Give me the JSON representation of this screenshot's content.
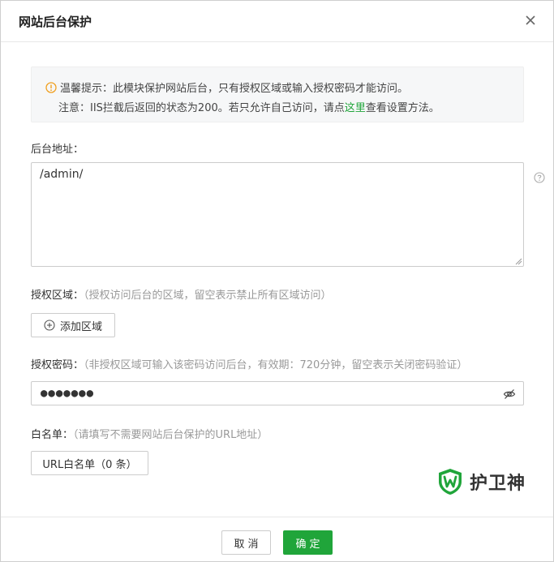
{
  "dialog": {
    "title": "网站后台保护",
    "close_icon": "close-icon"
  },
  "notice": {
    "icon": "warning-circle-icon",
    "line1": "温馨提示：此模块保护网站后台，只有授权区域或输入授权密码才能访问。",
    "line2_before": "注意：IIS拦截后返回的状态为200。若只允许自己访问，请点",
    "line2_link": "这里",
    "line2_after": "查看设置方法。"
  },
  "backend_path": {
    "label": "后台地址：",
    "value": "/admin/",
    "help_icon": "question-circle-icon"
  },
  "auth_region": {
    "label": "授权区域：",
    "hint": "（授权访问后台的区域，留空表示禁止所有区域访问）",
    "add_button_label": "添加区域",
    "add_icon": "plus-circle-icon"
  },
  "auth_password": {
    "label": "授权密码：",
    "hint": "（非授权区域可输入该密码访问后台，有效期：720分钟，留空表示关闭密码验证）",
    "value": "●●●●●●●",
    "eye_icon": "eye-off-icon"
  },
  "whitelist": {
    "label": "白名单：",
    "hint": "（请填写不需要网站后台保护的URL地址）",
    "button_label": "URL白名单（0 条）"
  },
  "brand": {
    "name": "护卫神",
    "icon": "shield-w-logo"
  },
  "footer": {
    "cancel_label": "取消",
    "ok_label": "确定"
  },
  "colors": {
    "accent": "#20a53a",
    "warning": "#f0a020",
    "hint": "#999999"
  }
}
